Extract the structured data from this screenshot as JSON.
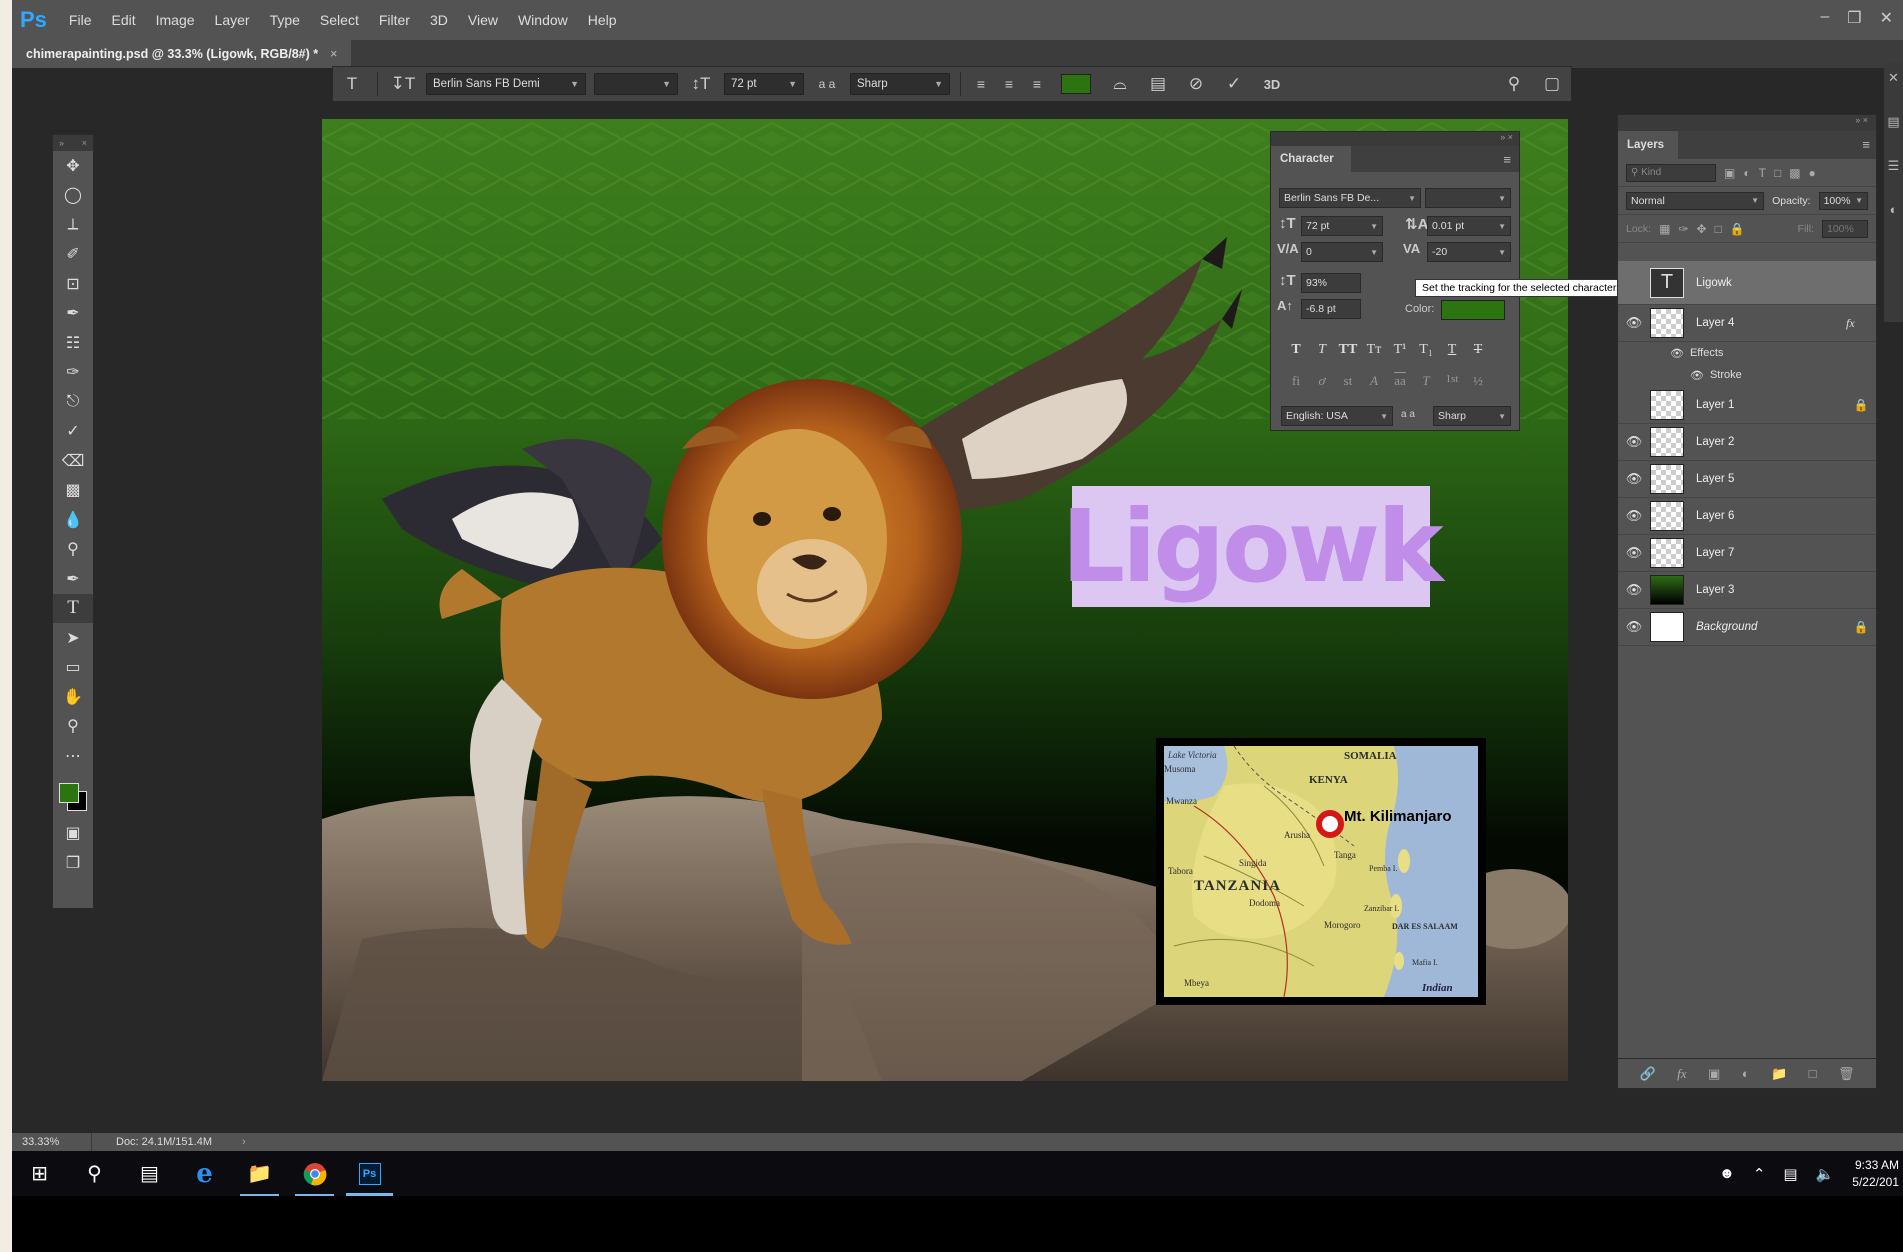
{
  "app": {
    "logo": "Ps",
    "menus": [
      "File",
      "Edit",
      "Image",
      "Layer",
      "Type",
      "Select",
      "Filter",
      "3D",
      "View",
      "Window",
      "Help"
    ]
  },
  "document_tab": {
    "title": "chimerapainting.psd @ 33.3% (Ligowk, RGB/8#) *",
    "close": "×"
  },
  "options_bar": {
    "font_family": "Berlin Sans FB Demi",
    "font_size": "72 pt",
    "aa_label": "a a",
    "antialias": "Sharp",
    "text_color": "#2b7410",
    "commit_3d": "3D"
  },
  "toolbar": {
    "tools": [
      "move-tool",
      "marquee-tool",
      "lasso-tool",
      "quick-selection-tool",
      "crop-tool",
      "eyedropper-tool",
      "healing-brush-tool",
      "brush-tool",
      "clone-stamp-tool",
      "history-brush-tool",
      "eraser-tool",
      "gradient-tool",
      "blur-tool",
      "dodge-tool",
      "pen-tool",
      "type-tool",
      "path-selection-tool",
      "rectangle-tool",
      "hand-tool",
      "zoom-tool",
      "more-tools"
    ],
    "active_tool": "type-tool",
    "foreground_color": "#2b7410",
    "background_color": "#000000"
  },
  "canvas": {
    "title_text": "Ligowk",
    "map": {
      "labels": {
        "somalia": "SOMALIA",
        "kenya": "KENYA",
        "kilimanjaro": "Mt. Kilimanjaro",
        "tanzania": "TANZANIA",
        "lake_victoria": "Lake Victoria",
        "dar": "DAR ES SALAAM",
        "indian": "Indian",
        "zanzibar": "Zanzibar I.",
        "pemba": "Pemba I.",
        "mafia": "Mafia I.",
        "arusha": "Arusha",
        "dodoma": "Dodoma",
        "tabora": "Tabora",
        "mwanza": "Mwanza",
        "singida": "Singida",
        "mbeya": "Mbeya",
        "morogoro": "Morogoro",
        "tanga": "Tanga",
        "musoma": "Musoma"
      }
    }
  },
  "character_panel": {
    "title": "Character",
    "font_family": "Berlin Sans FB De...",
    "font_size": "72 pt",
    "leading": "0.01 pt",
    "kerning": "0",
    "tracking": "-20",
    "vertical_scale": "93%",
    "baseline_shift": "-6.8 pt",
    "color_label": "Color:",
    "color": "#2b7410",
    "language": "English: USA",
    "antialias": "Sharp",
    "style_buttons": [
      "T",
      "T",
      "TT",
      "Tт",
      "T¹",
      "T₁",
      "T",
      "T"
    ],
    "opentype_buttons": [
      "fi",
      "ơ",
      "st",
      "A",
      "aa",
      "T",
      "1st",
      "½"
    ]
  },
  "tooltip": {
    "text": "Set the tracking for the selected characters"
  },
  "layers_panel": {
    "title": "Layers",
    "search_placeholder": "Kind",
    "blend_mode": "Normal",
    "opacity_label": "Opacity:",
    "opacity": "100%",
    "lock_label": "Lock:",
    "fill_label": "Fill:",
    "fill": "100%",
    "layers": [
      {
        "name": "Ligowk",
        "type": "text",
        "visible": false,
        "selected": true
      },
      {
        "name": "Layer 4",
        "visible": true,
        "fx": true
      },
      {
        "name": "Layer 1",
        "visible": false,
        "locked": true
      },
      {
        "name": "Layer 2",
        "visible": true
      },
      {
        "name": "Layer 5",
        "visible": true
      },
      {
        "name": "Layer 6",
        "visible": true
      },
      {
        "name": "Layer 7",
        "visible": true
      },
      {
        "name": "Layer 3",
        "visible": true
      },
      {
        "name": "Background",
        "visible": true,
        "locked": true
      }
    ],
    "effects_label": "Effects",
    "stroke_label": "Stroke",
    "fx_label": "fx"
  },
  "status_bar": {
    "zoom": "33.33%",
    "doc_size": "Doc: 24.1M/151.4M",
    "arrow": "›"
  },
  "taskbar": {
    "time": "9:33 AM",
    "date": "5/22/201"
  }
}
